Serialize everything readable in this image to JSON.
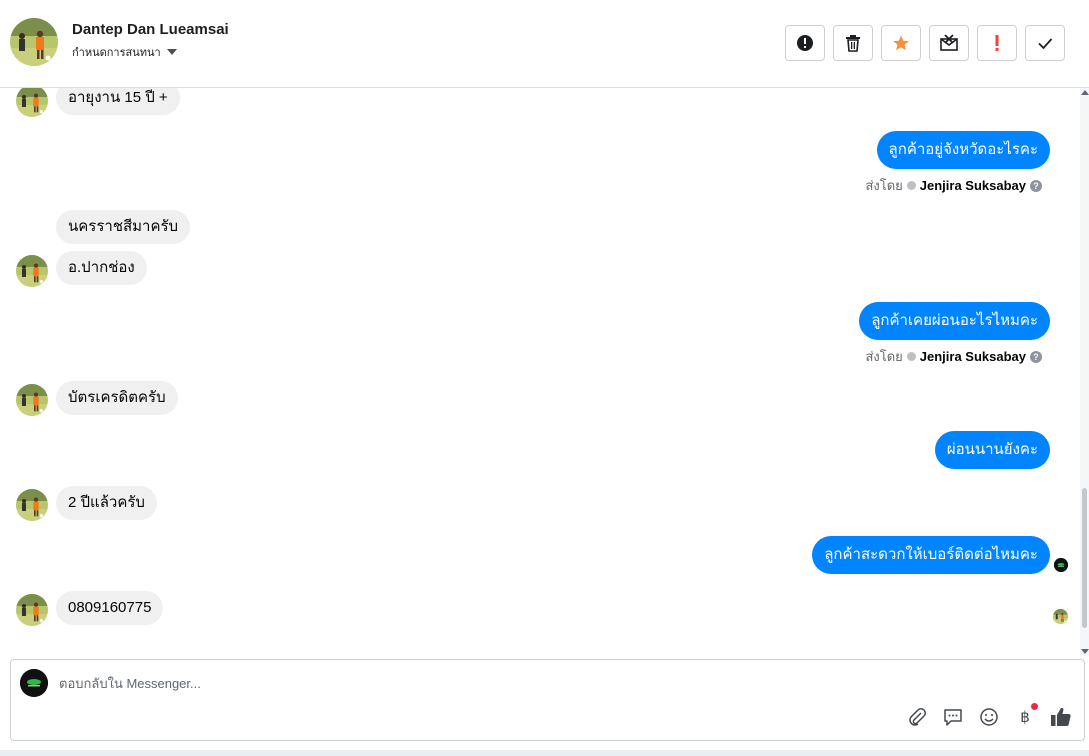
{
  "header": {
    "contact_name": "Dantep Dan Lueamsai",
    "label_action": "กำหนดการสนทนา",
    "toolbar": [
      {
        "name": "mark-spam-button",
        "icon": "exclamation-circle-icon"
      },
      {
        "name": "delete-button",
        "icon": "trash-icon"
      },
      {
        "name": "star-button",
        "icon": "star-icon",
        "color": "#f7923b"
      },
      {
        "name": "mark-unread-button",
        "icon": "envelope-x-icon"
      },
      {
        "name": "follow-up-button",
        "icon": "exclamation-icon",
        "color": "#fa3e3e"
      },
      {
        "name": "mark-done-button",
        "icon": "check-icon"
      }
    ]
  },
  "messages": [
    {
      "side": "in",
      "text": "อายุงาน 15 ปี +"
    },
    {
      "side": "out",
      "text": "ลูกค้าอยู่จังหวัดอะไรคะ",
      "sent_by_prefix": "ส่งโดย",
      "sent_by": "Jenjira Suksabay"
    },
    {
      "side": "in",
      "text": "นครราชสีมาครับ"
    },
    {
      "side": "in",
      "text": "อ.ปากช่อง"
    },
    {
      "side": "out",
      "text": "ลูกค้าเคยผ่อนอะไรไหมคะ",
      "sent_by_prefix": "ส่งโดย",
      "sent_by": "Jenjira Suksabay"
    },
    {
      "side": "in",
      "text": "บัตรเครดิตครับ"
    },
    {
      "side": "out",
      "text": "ผ่อนนานยังคะ"
    },
    {
      "side": "in",
      "text": "2 ปีแล้วครับ"
    },
    {
      "side": "out",
      "text": "ลูกค้าสะดวกให้เบอร์ติดต่อไหมคะ"
    },
    {
      "side": "in",
      "text": "0809160775"
    }
  ],
  "composer": {
    "placeholder": "ตอบกลับใน Messenger...",
    "tools": [
      "paperclip-icon",
      "saved-reply-icon",
      "emoji-icon",
      "payment-baht-icon",
      "like-icon"
    ],
    "baht_symbol": "฿"
  },
  "colors": {
    "accent": "#0084ff",
    "incoming_bubble": "#f0f0f0",
    "star": "#f7923b",
    "alert": "#fa3e3e"
  }
}
